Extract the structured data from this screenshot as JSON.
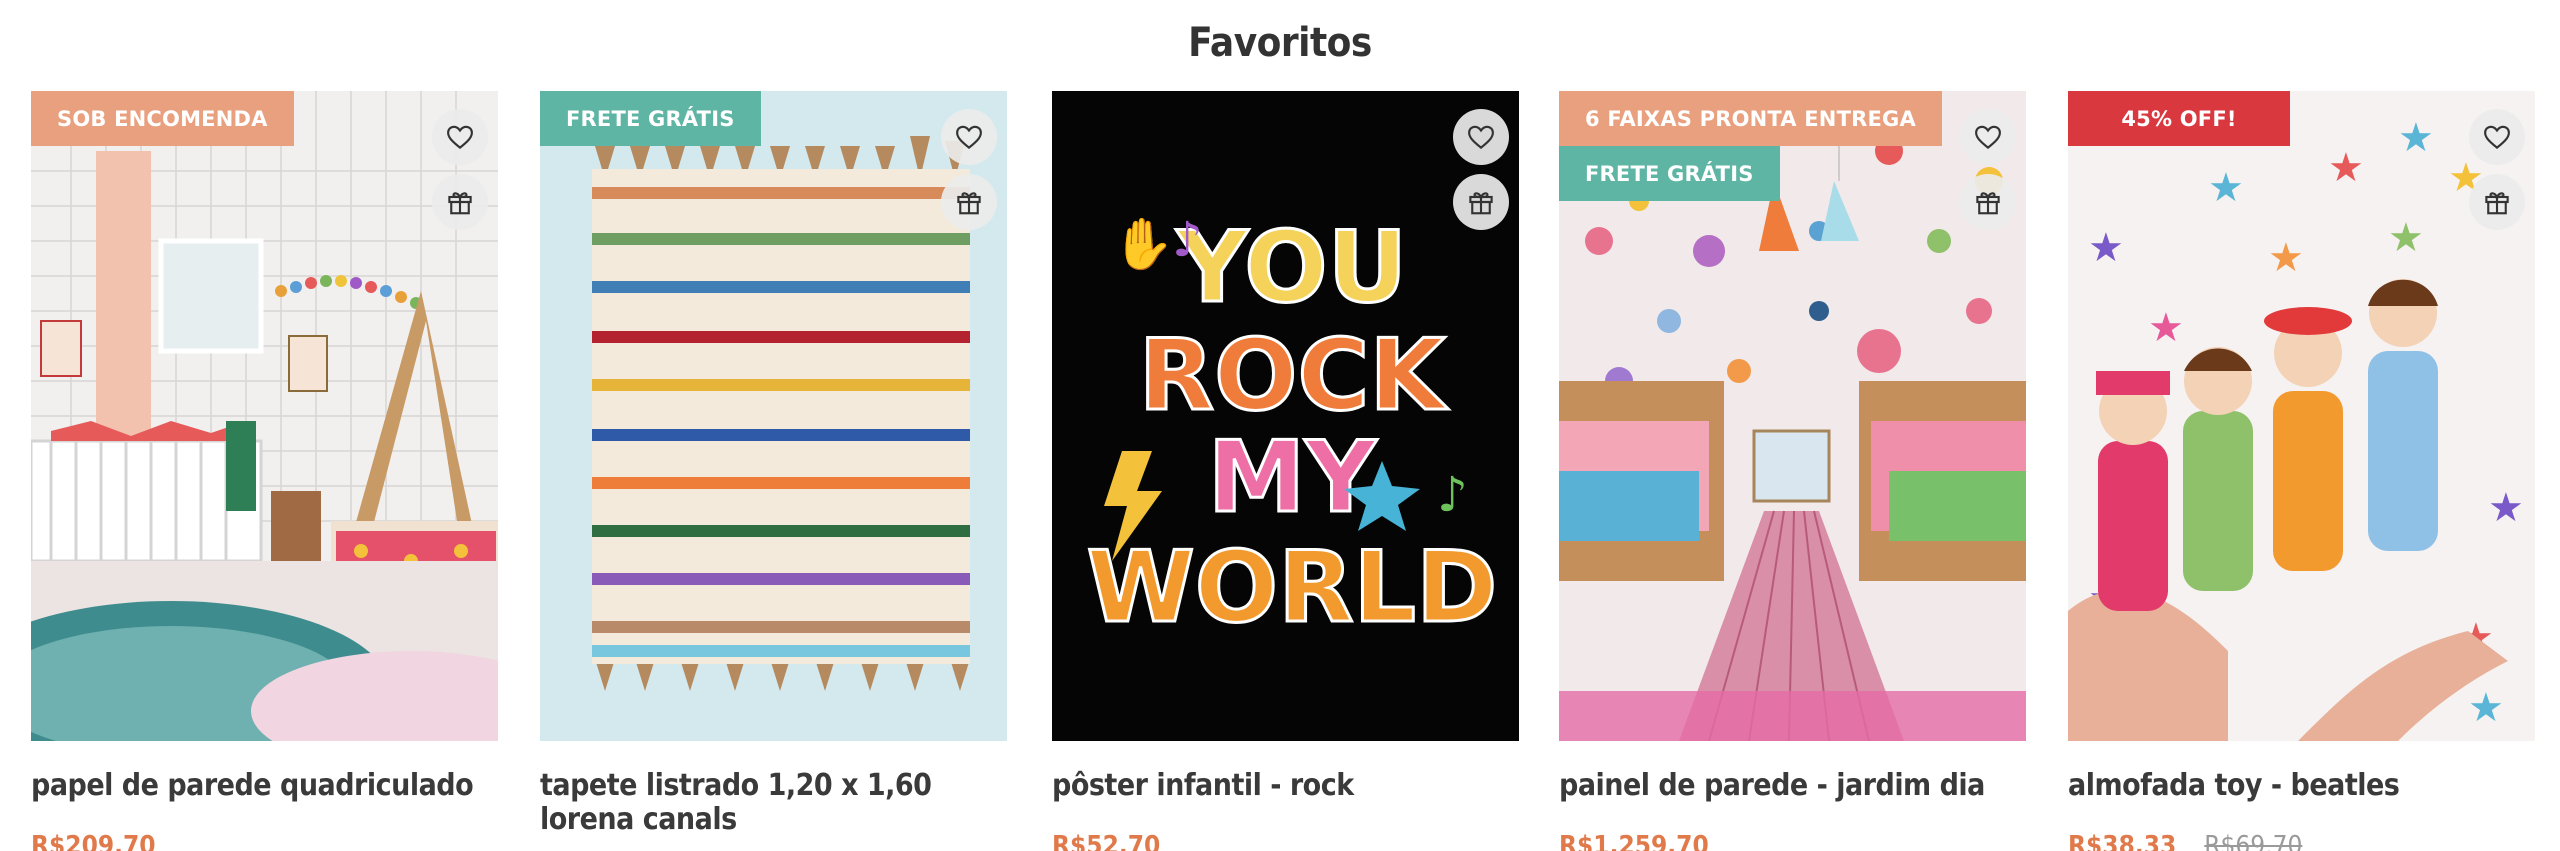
{
  "section": {
    "title": "Favoritos"
  },
  "colors": {
    "price": "#e07a4a",
    "badge_orange": "#e9a07e",
    "badge_green": "#5fb5a4",
    "badge_red": "#d9383f"
  },
  "icons": {
    "favorite": "heart-icon",
    "gift": "gift-icon"
  },
  "products": [
    {
      "badges": [
        "SOB ENCOMENDA"
      ],
      "name": "papel de parede quadriculado",
      "price": "R$209,70",
      "old_price": ""
    },
    {
      "badges": [
        "FRETE GRÁTIS"
      ],
      "name": "tapete listrado 1,20 x 1,60 lorena canals",
      "price": "",
      "old_price": ""
    },
    {
      "badges": [],
      "name": "pôster infantil - rock",
      "price": "R$52,70",
      "old_price": "",
      "art_text": [
        "YOU",
        "ROCK",
        "MY",
        "WORLD"
      ]
    },
    {
      "badges": [
        "6 FAIXAS PRONTA ENTREGA",
        "FRETE GRÁTIS"
      ],
      "name": "painel de parede - jardim dia",
      "price": "R$1.259,70",
      "old_price": ""
    },
    {
      "badges": [
        "45% OFF!"
      ],
      "name": "almofada toy - beatles",
      "price": "R$38,33",
      "old_price": "R$69,70"
    }
  ]
}
